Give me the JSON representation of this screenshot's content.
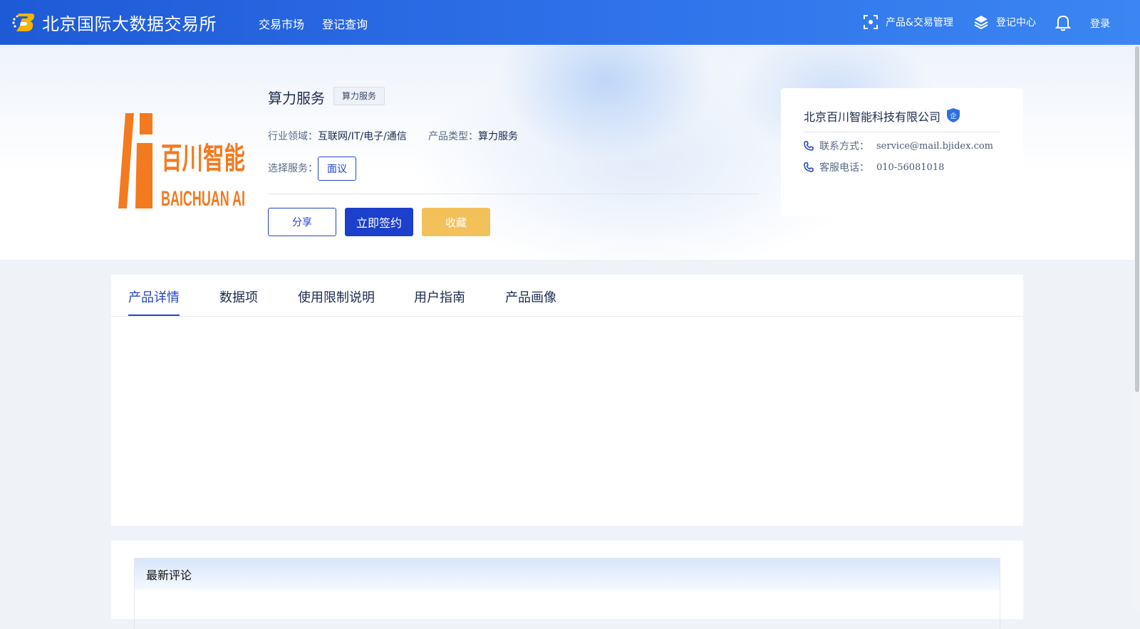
{
  "header": {
    "brand_name": "北京国际大数据交易所",
    "nav": {
      "market": "交易市场",
      "register_query": "登记查询"
    },
    "product_trade": "产品&交易管理",
    "register_center": "登记中心",
    "login": "登录"
  },
  "product": {
    "title": "算力服务",
    "tag": "算力服务",
    "industry_label": "行业领域：",
    "industry_value": "互联网/IT/电子/通信",
    "type_label": "产品类型：",
    "type_value": "算力服务",
    "service_label": "选择服务：",
    "service_option": "面议",
    "logo_text_cn": "百川智能",
    "logo_text_en": "BAICHUAN AI"
  },
  "actions": {
    "share": "分享",
    "sign": "立即签约",
    "favorite": "收藏"
  },
  "seller": {
    "name": "北京百川智能科技有限公司",
    "badge": "企",
    "contact_label": "联系方式：",
    "contact_value": "service@mail.bjidex.com",
    "phone_label": "客服电话：",
    "phone_value": "010-56081018"
  },
  "tabs": [
    {
      "label": "产品详情",
      "active": true
    },
    {
      "label": "数据项"
    },
    {
      "label": "使用限制说明"
    },
    {
      "label": "用户指南"
    },
    {
      "label": "产品画像"
    }
  ],
  "comments": {
    "title": "最新评论"
  },
  "colors": {
    "primary": "#1c3fcc",
    "favorite": "#f3c159",
    "logo_orange": "#f47a1f"
  }
}
